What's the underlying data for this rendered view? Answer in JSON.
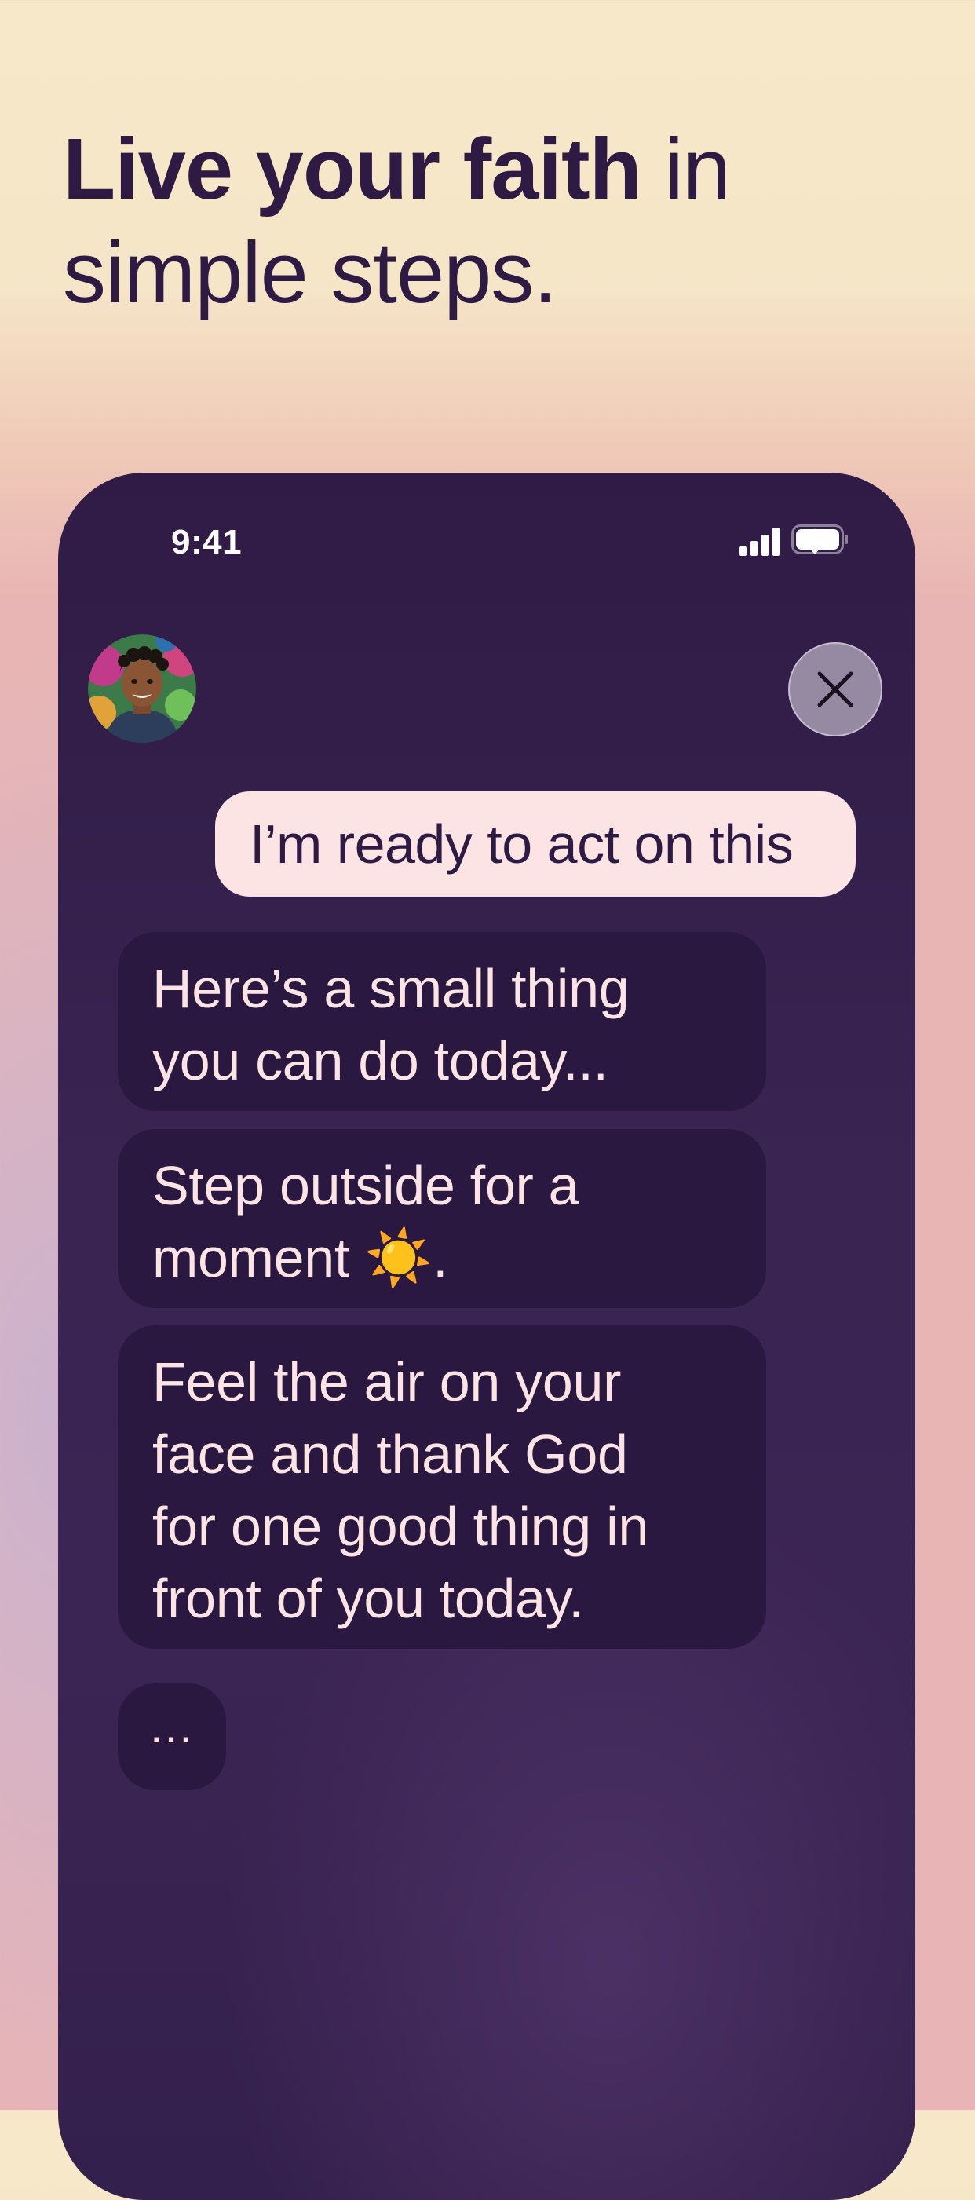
{
  "headline": {
    "bold_text": "Live your faith",
    "rest_text": " in simple steps."
  },
  "status_bar": {
    "time": "9:41",
    "icons": [
      "signal-icon",
      "wifi-icon",
      "battery-icon"
    ]
  },
  "chat": {
    "avatar_icon": "avatar-portrait",
    "close_icon": "close-icon",
    "user_message": "I’m ready to act on this",
    "bot_messages": [
      {
        "lines": [
          "Here’s a small thing",
          "you can do today..."
        ]
      },
      {
        "lines": [
          "Step outside for a",
          "moment ☀️."
        ]
      },
      {
        "lines": [
          "Feel the air on your",
          "face and thank God",
          "for one good thing in",
          "front of you today."
        ]
      }
    ],
    "typing_indicator": "..."
  },
  "colors": {
    "background_top": "#f6e8c9",
    "background_bottom": "#e9b4b5",
    "phone_background": "#34204c",
    "bot_bubble": "#2a1841",
    "user_bubble": "#fbe4e3",
    "headline_text": "#2e1a43"
  }
}
